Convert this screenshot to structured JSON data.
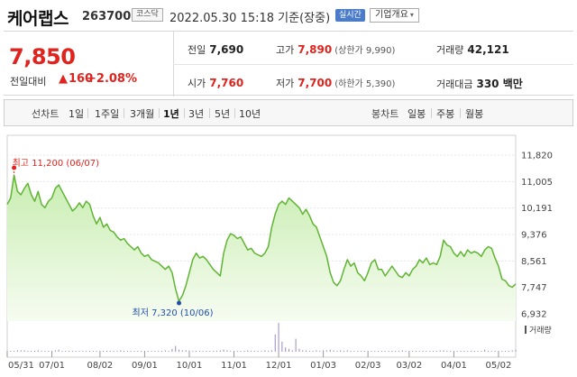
{
  "header": {
    "stock_name": "케어랩스",
    "stock_code": "263700",
    "market_badge": "코스닥",
    "datetime": "2022.05.30 15:18 기준(장중)",
    "realtime_badge": "실시간",
    "overview_dropdown": "기업개요"
  },
  "quote": {
    "price": "7,850",
    "change_label": "전일대비",
    "change_arrow": "▲",
    "change": "160",
    "change_pct": "+2.08%",
    "prev_close_label": "전일",
    "prev_close": "7,690",
    "high_label": "고가",
    "high": "7,890",
    "upper_limit": "(상한가 9,990)",
    "volume_label": "거래량",
    "volume": "42,121",
    "open_label": "시가",
    "open": "7,760",
    "low_label": "저가",
    "low": "7,700",
    "lower_limit": "(하한가 5,390)",
    "amount_label": "거래대금",
    "amount": "330 백만"
  },
  "toolbar": {
    "line_label": "선차트",
    "periods": [
      "1일",
      "1주일",
      "3개월",
      "1년",
      "3년",
      "5년",
      "10년"
    ],
    "active_period": "1년",
    "candle_label": "봉차트",
    "candles": [
      "일봉",
      "주봉",
      "월봉"
    ]
  },
  "chart_data": {
    "type": "area",
    "title": "",
    "xlabel": "",
    "ylabel": "",
    "yticks": [
      "11,820",
      "11,005",
      "10,191",
      "9,376",
      "8,561",
      "7,747",
      "6,932"
    ],
    "xticks": [
      "05/31",
      "07/01",
      "08/02",
      "09/01",
      "10/01",
      "11/01",
      "12/01",
      "01/03",
      "02/03",
      "03/02",
      "04/01",
      "05/02"
    ],
    "ylim": [
      6932,
      11820
    ],
    "high_annotation": "최고 11,200 (06/07)",
    "low_annotation": "최저 7,320 (10/06)",
    "volume_legend": "거래량",
    "colors": {
      "line": "#5fb533",
      "fill_top": "#c8edb0",
      "fill_bottom": "#f6fcf1",
      "high": "#e0231d",
      "low": "#1f4fa8",
      "volume": "#9a8bbf"
    },
    "series": [
      {
        "values": [
          10300,
          10500,
          11200,
          10700,
          10600,
          10800,
          10950,
          10600,
          10400,
          10700,
          10300,
          10200,
          10400,
          10500,
          10800,
          10900,
          10700,
          10500,
          10300,
          10100,
          10200,
          10350,
          10200,
          10400,
          10300,
          9950,
          9700,
          9900,
          9600,
          9700,
          9500,
          9450,
          9300,
          9200,
          9250,
          9100,
          9000,
          8900,
          9000,
          8800,
          8700,
          8750,
          8600,
          8550,
          8500,
          8400,
          8300,
          8400,
          8200,
          7700,
          7320,
          7500,
          7800,
          8200,
          8600,
          8800,
          8650,
          8700,
          8600,
          8450,
          8300,
          8200,
          8100,
          8800,
          9200,
          9400,
          9350,
          9250,
          9300,
          9100,
          8900,
          8950,
          8800,
          8750,
          8700,
          8800,
          9000,
          9600,
          10000,
          10300,
          10400,
          10300,
          10500,
          10400,
          10300,
          10200,
          10000,
          10150,
          9950,
          9700,
          9600,
          9300,
          9000,
          8700,
          8200,
          7900,
          7800,
          7950,
          8300,
          8600,
          8400,
          8500,
          8200,
          8100,
          7950,
          8200,
          8500,
          8600,
          8300,
          8300,
          8100,
          8250,
          8400,
          8250,
          8100,
          8050,
          8200,
          8100,
          8300,
          8400,
          8600,
          8500,
          8650,
          8450,
          8500,
          8450,
          8700,
          9200,
          9050,
          9000,
          8800,
          8700,
          8850,
          8700,
          8900,
          8800,
          8850,
          8800,
          8700,
          8900,
          9000,
          8950,
          8650,
          8400,
          8000,
          7950,
          7800,
          7750,
          7850
        ]
      }
    ],
    "volume": [
      1,
      1,
      1,
      2,
      2,
      2,
      1,
      1,
      1,
      2,
      1,
      1,
      1,
      1,
      2,
      3,
      1,
      1,
      1,
      1,
      1,
      1,
      1,
      1,
      1,
      1,
      1,
      1,
      1,
      1,
      1,
      1,
      1,
      2,
      1,
      1,
      1,
      1,
      1,
      1,
      1,
      1,
      1,
      1,
      1,
      1,
      2,
      1,
      4,
      8,
      3,
      2,
      2,
      2,
      1,
      1,
      1,
      1,
      1,
      1,
      1,
      1,
      2,
      3,
      2,
      1,
      1,
      1,
      1,
      1,
      2,
      1,
      1,
      1,
      1,
      2,
      1,
      2,
      24,
      40,
      14,
      6,
      4,
      2,
      18,
      4,
      2,
      2,
      1,
      1,
      2,
      1,
      2,
      2,
      3,
      2,
      1,
      2,
      1,
      2,
      1,
      1,
      1,
      1,
      1,
      1,
      1,
      1,
      1,
      1,
      1,
      1,
      1,
      1,
      1,
      2,
      1,
      1,
      1,
      1,
      1,
      1,
      1,
      1,
      1,
      1,
      2,
      2,
      1,
      1,
      1,
      1,
      1,
      1,
      1,
      1,
      1,
      1,
      1,
      3,
      1,
      1,
      1,
      1,
      1,
      1,
      1,
      2,
      3
    ]
  }
}
